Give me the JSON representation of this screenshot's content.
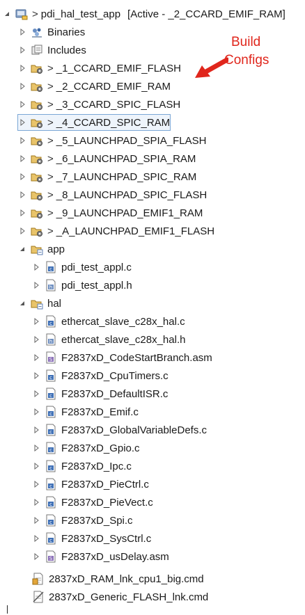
{
  "project": {
    "prefix": ">",
    "name": "pdi_hal_test_app",
    "status": "[Active - _2_CCARD_EMIF_RAM]"
  },
  "annotation": {
    "line1": "Build",
    "line2": "Configs"
  },
  "folders": {
    "binaries": "Binaries",
    "includes": "Includes",
    "app": "app",
    "hal": "hal"
  },
  "build_configs": [
    "_1_CCARD_EMIF_FLASH",
    "_2_CCARD_EMIF_RAM",
    "_3_CCARD_SPIC_FLASH",
    "_4_CCARD_SPIC_RAM",
    "_5_LAUNCHPAD_SPIA_FLASH",
    "_6_LAUNCHPAD_SPIA_RAM",
    "_7_LAUNCHPAD_SPIC_RAM",
    "_8_LAUNCHPAD_SPIC_FLASH",
    "_9_LAUNCHPAD_EMIF1_RAM",
    "_A_LAUNCHPAD_EMIF1_FLASH"
  ],
  "config_prefix": ">",
  "app_files": [
    "pdi_test_appl.c",
    "pdi_test_appl.h"
  ],
  "hal_files": [
    "ethercat_slave_c28x_hal.c",
    "ethercat_slave_c28x_hal.h",
    "F2837xD_CodeStartBranch.asm",
    "F2837xD_CpuTimers.c",
    "F2837xD_DefaultISR.c",
    "F2837xD_Emif.c",
    "F2837xD_GlobalVariableDefs.c",
    "F2837xD_Gpio.c",
    "F2837xD_Ipc.c",
    "F2837xD_PieCtrl.c",
    "F2837xD_PieVect.c",
    "F2837xD_Spi.c",
    "F2837xD_SysCtrl.c",
    "F2837xD_usDelay.asm"
  ],
  "root_files": [
    "2837xD_RAM_lnk_cpu1_big.cmd",
    "2837xD_Generic_FLASH_lnk.cmd"
  ]
}
